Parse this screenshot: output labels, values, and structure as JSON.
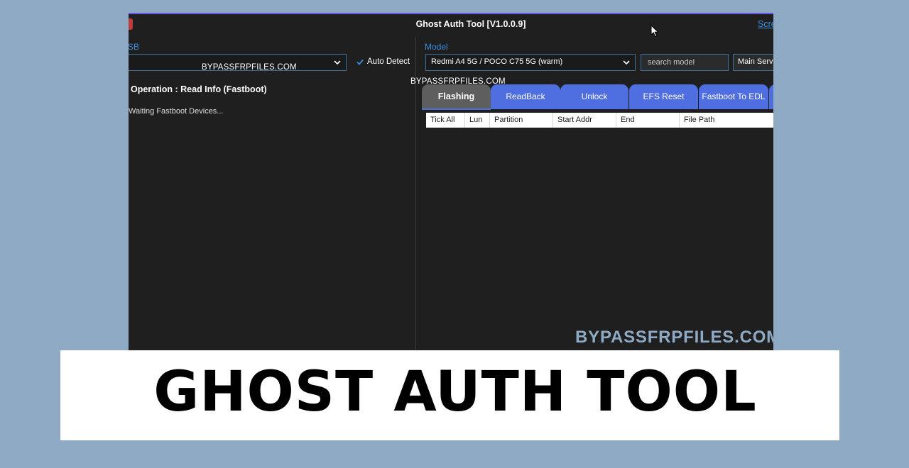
{
  "window": {
    "title": "Ghost Auth Tool [V1.0.0.9]",
    "screen_link": "Scre"
  },
  "left_panel": {
    "usb_label": "SB",
    "port_value": "BYPASSFRPFILES.COM",
    "auto_detect_label": "Auto Detect",
    "auto_detect_checked": true,
    "operation": "Operation : Read Info (Fastboot)",
    "log_lines": [
      "Waiting Fastboot Devices..."
    ]
  },
  "right_panel": {
    "model_label": "Model",
    "model_value": "Redmi A4 5G / POCO C75 5G (warm)",
    "search_placeholder": "search model",
    "server_value": "Main Serve",
    "watermark": "BYPASSFRPFILES.COM",
    "tabs": [
      {
        "label": "Flashing",
        "active": true
      },
      {
        "label": "ReadBack",
        "active": false
      },
      {
        "label": "Unlock",
        "active": false
      },
      {
        "label": "EFS Reset",
        "active": false
      },
      {
        "label": "Fastboot To EDL",
        "active": false
      }
    ],
    "grid_columns": [
      "Tick All",
      "Lun",
      "Partition",
      "Start Addr",
      "End",
      "File Path"
    ]
  },
  "overlay": {
    "watermark": "BYPASSFRPFILES.COM",
    "banner_title": "GHOST AUTH TOOL"
  },
  "colors": {
    "window_bg": "#1f1f1f",
    "accent_blue": "#4f6ee0",
    "label_blue": "#3b8ede",
    "page_bg": "#8eaac4"
  },
  "icons": [
    "app-icon",
    "chevron-down-icon",
    "check-icon",
    "mouse-cursor-icon"
  ]
}
